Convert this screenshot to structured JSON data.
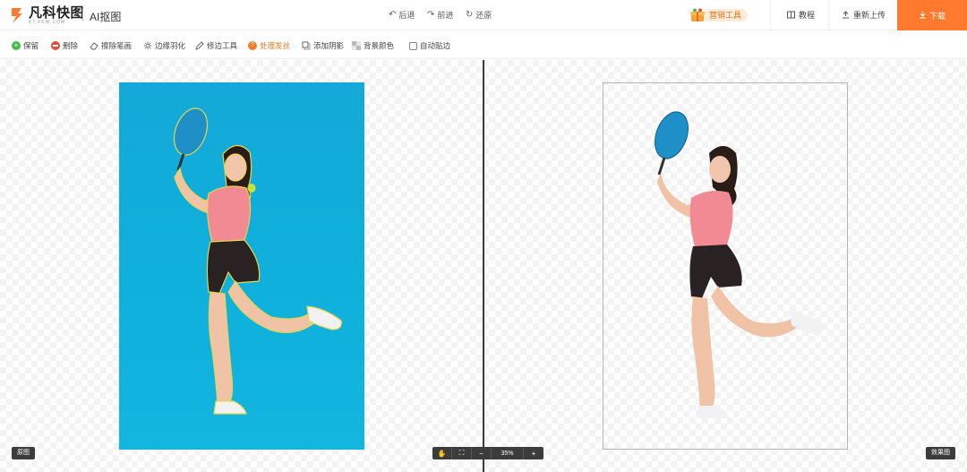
{
  "header": {
    "logo_main": "凡科快图",
    "logo_sub": "KT.FKW.COM",
    "tool_title": "AI抠图",
    "undo_label": "后退",
    "redo_label": "前进",
    "restore_label": "还原",
    "marketing_label": "营销工具",
    "tutorial_label": "教程",
    "reupload_label": "重新上传",
    "download_label": "下载",
    "accent_color": "#ff7a2e"
  },
  "toolbar": {
    "items": [
      {
        "label": "保留",
        "icon": "plus-circle-icon"
      },
      {
        "label": "删除",
        "icon": "minus-circle-icon"
      },
      {
        "label": "擦除笔画",
        "icon": "eraser-icon"
      },
      {
        "label": "边缘羽化",
        "icon": "feather-icon"
      },
      {
        "label": "修边工具",
        "icon": "pen-icon"
      },
      {
        "label": "处理发丝",
        "icon": "hair-icon",
        "active": true
      },
      {
        "label": "添加阴影",
        "icon": "shadow-icon"
      },
      {
        "label": "背景颜色",
        "icon": "bg-color-icon"
      },
      {
        "label": "自动贴边",
        "icon": "checkbox-icon",
        "checked": false
      }
    ]
  },
  "canvas": {
    "original_label": "原图",
    "result_label": "效果图",
    "zoom_value": "35%",
    "zoom_minus": "−",
    "zoom_plus": "+"
  }
}
